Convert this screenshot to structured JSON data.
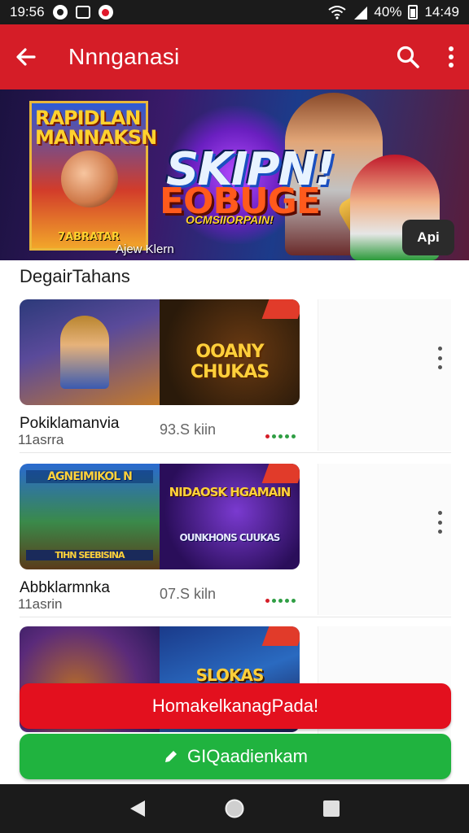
{
  "status_bar": {
    "time": "19:56",
    "battery": "40%",
    "clock": "14:49"
  },
  "app_bar": {
    "title": "Nnnganasi"
  },
  "banner": {
    "poster_title": "RAPIDLAN MANNAKSN",
    "poster_subtitle": "7ABRATAR",
    "caption": "Ajew Klern",
    "headline_1": "SKIPN!",
    "headline_2": "EOBUGE",
    "tagline": "OCMSIIORPAIN!",
    "badge": "Api"
  },
  "section": {
    "title": "DegairTahans"
  },
  "items": [
    {
      "name": "Pokiklamanvia",
      "sub": "11asrra",
      "size": "93.S kiin",
      "thumb_right_text": "OOANY CHUKAS",
      "thumb_left_text": ""
    },
    {
      "name": "Abbklarmnka",
      "sub": "11asrin",
      "size": "07.S kiln",
      "thumb_left_text": "AGNEIMIKOL N",
      "thumb_left_bottom": "TIHN SEEBISINA",
      "thumb_right_text": "NIDAOSK HGAMAIN",
      "thumb_right_bottom": "OUNKHONS CUUKAS"
    },
    {
      "name": "",
      "sub": "",
      "size": "",
      "thumb_right_text": "SLOKAS"
    }
  ],
  "buttons": {
    "primary": "HomakelkanagPada!",
    "secondary": "GIQaadienkam"
  },
  "colors": {
    "app_bar": "#d51d27",
    "primary_button": "#e3101e",
    "secondary_button": "#20b33f"
  },
  "icons": [
    "back-arrow-icon",
    "search-icon",
    "overflow-menu-icon",
    "wifi-icon",
    "signal-icon",
    "battery-icon",
    "pencil-icon",
    "nav-back-icon",
    "nav-home-icon",
    "nav-recents-icon"
  ]
}
